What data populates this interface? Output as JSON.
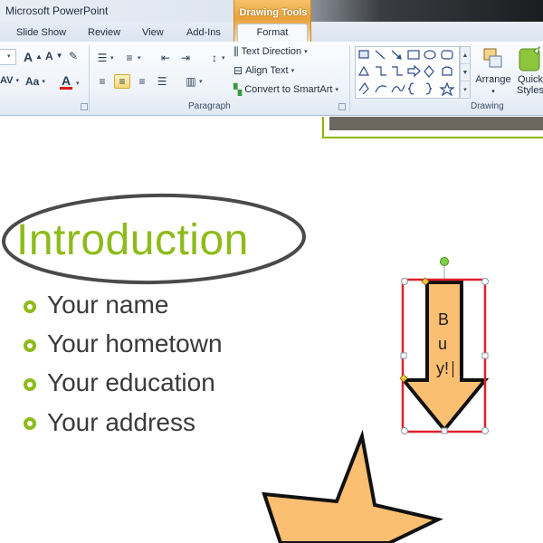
{
  "app": {
    "title": "Microsoft PowerPoint"
  },
  "contextual": {
    "group_label": "Drawing Tools",
    "tab_label": "Format"
  },
  "tabs": [
    {
      "label": "Slide Show"
    },
    {
      "label": "Review"
    },
    {
      "label": "View"
    },
    {
      "label": "Add-Ins"
    }
  ],
  "ribbon": {
    "font_group": {
      "grow_font": "A",
      "shrink_font": "A",
      "spacing": "AV",
      "change_case": "Aa",
      "font_color": "A",
      "font_color_hex": "#e01818"
    },
    "paragraph": {
      "label": "Paragraph",
      "text_direction": "Text Direction",
      "align_text": "Align Text",
      "convert_smartart": "Convert to SmartArt"
    },
    "drawing": {
      "label": "Drawing",
      "arrange": "Arrange",
      "quick_styles_line1": "Quick",
      "quick_styles_line2": "Styles"
    }
  },
  "slide": {
    "title": "Introduction",
    "bullets": [
      {
        "text": "Your name"
      },
      {
        "text": "Your hometown"
      },
      {
        "text": "Your education"
      },
      {
        "text": "Your address"
      }
    ],
    "arrow_text": [
      "B",
      "u",
      "y!"
    ],
    "colors": {
      "accent": "#8dbb1a",
      "shape_fill": "#fbbf72",
      "selection": "#e0202a"
    }
  }
}
